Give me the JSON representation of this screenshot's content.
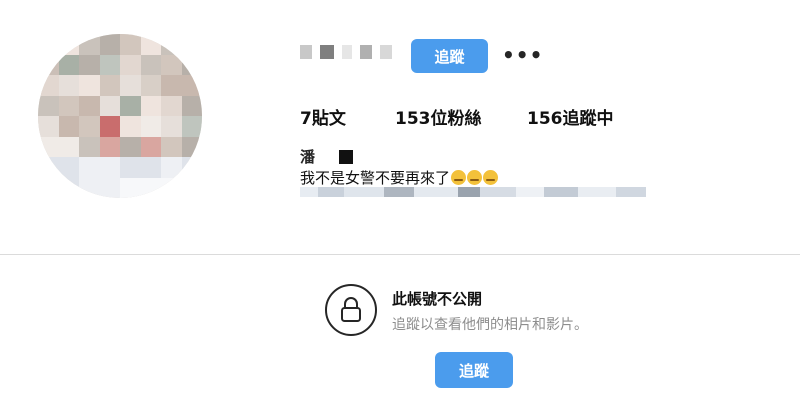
{
  "profile": {
    "follow_label": "追蹤",
    "more_glyph": "•••",
    "stats": {
      "posts": "7貼文",
      "followers": "153位粉絲",
      "following": "156追蹤中"
    },
    "name_visible": "潘",
    "bio_line": "我不是女警不要再來了"
  },
  "private_notice": {
    "title": "此帳號不公開",
    "subtitle": "追蹤以查看他們的相片和影片。",
    "follow_label": "追蹤"
  },
  "colors": {
    "accent": "#4b9ced",
    "divider": "#dbdbdb",
    "muted_text": "#8e8e8e"
  },
  "icons": [
    "lock-icon",
    "more-options-icon",
    "pensive-emoji-icon"
  ]
}
